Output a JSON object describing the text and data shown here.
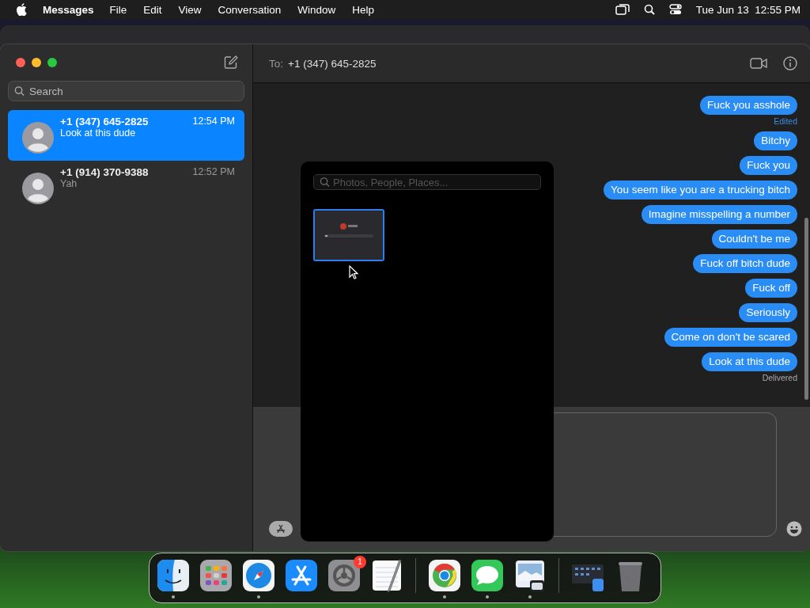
{
  "menu_bar": {
    "app": "Messages",
    "menus": [
      "File",
      "Edit",
      "View",
      "Conversation",
      "Window",
      "Help"
    ],
    "clock": "Tue Jun 13  12:55 PM"
  },
  "sidebar": {
    "search": {
      "placeholder": "Search"
    },
    "conversations": [
      {
        "name": "+1 (347) 645-2825",
        "preview": "Look at this dude",
        "time": "12:54 PM",
        "selected": true
      },
      {
        "name": "+1 (914) 370-9388",
        "preview": "Yah",
        "time": "12:52 PM",
        "selected": false
      }
    ]
  },
  "chat": {
    "to_label": "To:",
    "recipient": "+1 (347) 645-2825",
    "messages": [
      {
        "text": "Fuck you asshole",
        "note": {
          "kind": "edited",
          "text": "Edited"
        }
      },
      {
        "text": "Bitchy"
      },
      {
        "text": "Fuck you"
      },
      {
        "text": "You seem like you are a trucking bitch"
      },
      {
        "text": "Imagine misspelling a number"
      },
      {
        "text": "Couldn't be me"
      },
      {
        "text": "Fuck off bitch dude"
      },
      {
        "text": "Fuck off"
      },
      {
        "text": "Seriously"
      },
      {
        "text": "Come on don't be scared"
      },
      {
        "text": "Look at this dude",
        "note": {
          "kind": "status",
          "text": "Delivered"
        }
      }
    ]
  },
  "photo_picker": {
    "search": {
      "placeholder": "Photos, People, Places..."
    },
    "thumbnails": [
      {
        "kind": "picture",
        "selected": true
      }
    ]
  },
  "dock": [
    {
      "kind": "finder",
      "running": true
    },
    {
      "kind": "launchpad",
      "running": false
    },
    {
      "kind": "safari",
      "running": true
    },
    {
      "kind": "appstore",
      "running": false
    },
    {
      "kind": "settings",
      "running": false,
      "badge": "1"
    },
    {
      "kind": "textedit",
      "running": false
    },
    {
      "kind": "separator"
    },
    {
      "kind": "chrome",
      "running": true
    },
    {
      "kind": "messages",
      "running": true
    },
    {
      "kind": "preview",
      "running": true
    },
    {
      "kind": "separator"
    },
    {
      "kind": "stack",
      "running": false
    },
    {
      "kind": "trash",
      "running": false
    }
  ]
}
